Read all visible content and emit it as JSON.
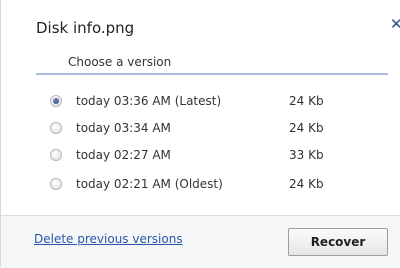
{
  "dialog": {
    "title": "Disk info.png",
    "close_glyph": "✕",
    "subtitle": "Choose a version"
  },
  "versions": [
    {
      "label": "today 03:36 AM (Latest)",
      "size": "24 Kb",
      "selected": true
    },
    {
      "label": "today 03:34 AM",
      "size": "24 Kb",
      "selected": false
    },
    {
      "label": "today 02:27 AM",
      "size": "33 Kb",
      "selected": false
    },
    {
      "label": "today 02:21 AM (Oldest)",
      "size": "24 Kb",
      "selected": false
    }
  ],
  "footer": {
    "delete_link": "Delete previous versions",
    "recover_label": "Recover"
  },
  "colors": {
    "accent_link": "#2a57a8",
    "rule": "#a9bde0",
    "footer_bg": "#f5f6f8"
  }
}
